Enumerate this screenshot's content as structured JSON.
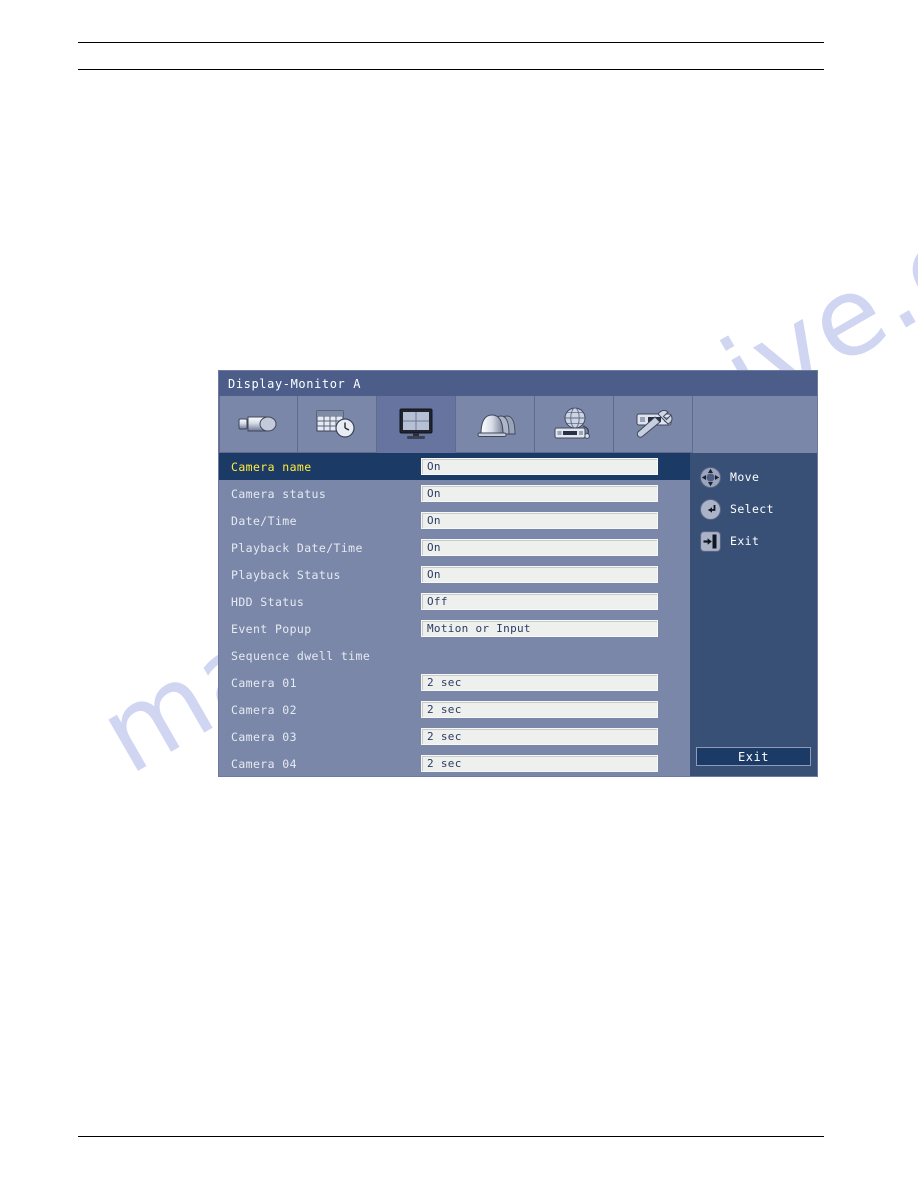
{
  "page": {
    "watermark_text": "manualsarchive.com"
  },
  "osd": {
    "title": "Display-Monitor A",
    "tabs": [
      {
        "name": "camera",
        "icon": "camcorder-icon",
        "active": false
      },
      {
        "name": "schedule",
        "icon": "calendar-clock-icon",
        "active": false
      },
      {
        "name": "display",
        "icon": "monitor-icon",
        "active": true
      },
      {
        "name": "event",
        "icon": "bells-icon",
        "active": false
      },
      {
        "name": "network",
        "icon": "globe-recorder-icon",
        "active": false
      },
      {
        "name": "system",
        "icon": "wrench-recorder-icon",
        "active": false
      }
    ],
    "rows": [
      {
        "label": "Camera name",
        "value": "On",
        "selected": true,
        "has_value": true
      },
      {
        "label": "Camera status",
        "value": "On",
        "selected": false,
        "has_value": true
      },
      {
        "label": "Date/Time",
        "value": "On",
        "selected": false,
        "has_value": true
      },
      {
        "label": "Playback Date/Time",
        "value": "On",
        "selected": false,
        "has_value": true
      },
      {
        "label": "Playback Status",
        "value": "On",
        "selected": false,
        "has_value": true
      },
      {
        "label": "HDD Status",
        "value": "Off",
        "selected": false,
        "has_value": true
      },
      {
        "label": "Event Popup",
        "value": "Motion or Input",
        "selected": false,
        "has_value": true
      },
      {
        "label": "Sequence dwell time",
        "value": "",
        "selected": false,
        "has_value": false
      },
      {
        "label": "Camera 01",
        "value": "2 sec",
        "selected": false,
        "has_value": true
      },
      {
        "label": "Camera 02",
        "value": "2 sec",
        "selected": false,
        "has_value": true
      },
      {
        "label": "Camera 03",
        "value": "2 sec",
        "selected": false,
        "has_value": true
      },
      {
        "label": "Camera 04",
        "value": "2 sec",
        "selected": false,
        "has_value": true
      }
    ],
    "helper": {
      "items": [
        {
          "label": "Move",
          "icon": "dpad-icon"
        },
        {
          "label": "Select",
          "icon": "enter-key-icon"
        },
        {
          "label": "Exit",
          "icon": "exit-arrow-icon"
        }
      ],
      "exit_button": "Exit"
    },
    "colors": {
      "panel_bg": "#7b87a8",
      "title_bar": "#4c5d8a",
      "helper_bg": "#385076",
      "selected_row": "#1c3a66",
      "selected_label": "#ffec3d",
      "value_field": "#eef0ee",
      "value_text": "#2c3a63",
      "watermark": "#aab4e8"
    }
  }
}
